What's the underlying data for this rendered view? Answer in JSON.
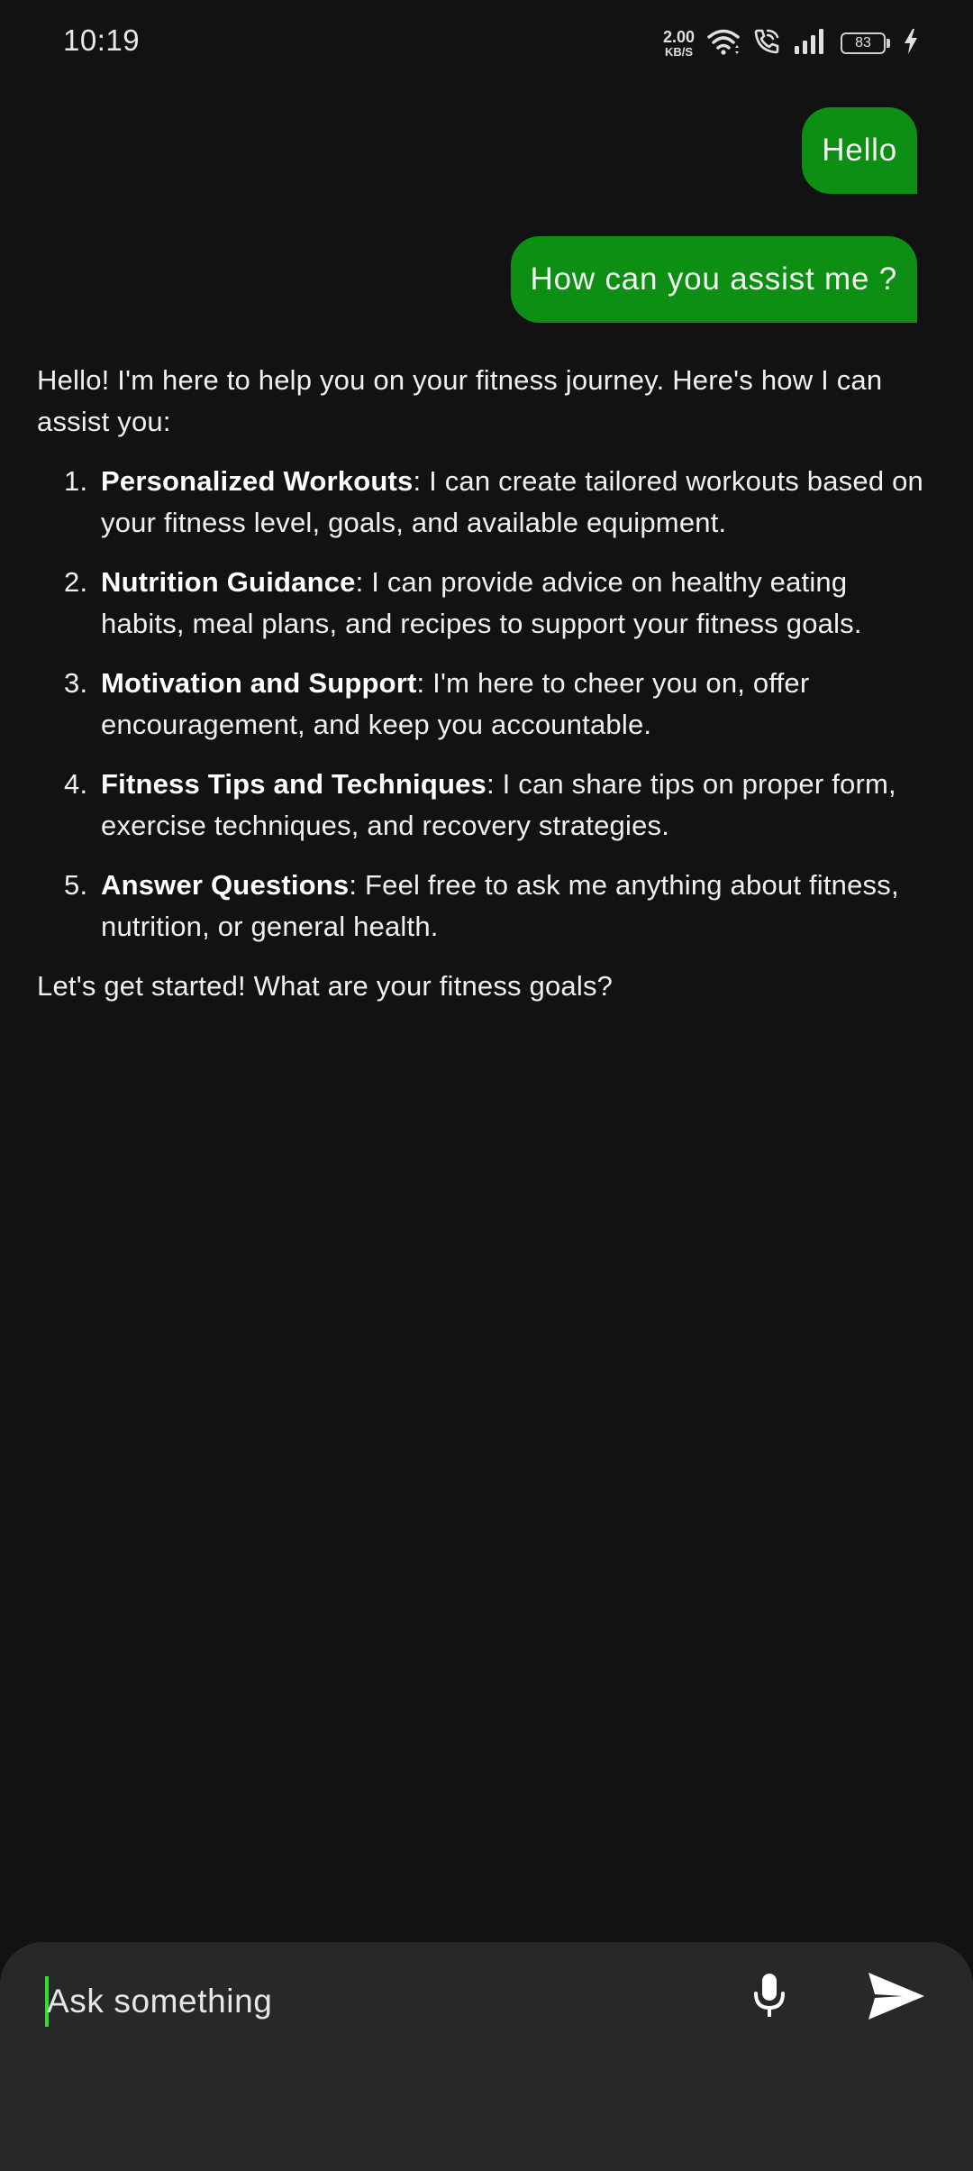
{
  "status_bar": {
    "time": "10:19",
    "net_speed_value": "2.00",
    "net_speed_unit": "KB/S",
    "battery_level": "83",
    "icons": [
      "wifi-icon",
      "wifi-call-icon",
      "signal-icon",
      "battery-icon",
      "charging-icon"
    ]
  },
  "messages": {
    "user": [
      {
        "text": "Hello"
      },
      {
        "text": "How can you assist me ?"
      }
    ],
    "assistant": {
      "intro": "Hello! I'm here to help you on your fitness journey. Here's how I can assist you:",
      "items": [
        {
          "number": "1.",
          "title": "Personalized Workouts",
          "text": ": I can create tailored workouts based on your fitness level, goals, and available equipment."
        },
        {
          "number": "2.",
          "title": "Nutrition Guidance",
          "text": ": I can provide advice on healthy eating habits, meal plans, and recipes to support your fitness goals."
        },
        {
          "number": "3.",
          "title": "Motivation and Support",
          "text": ": I'm here to cheer you on, offer encouragement, and keep you accountable."
        },
        {
          "number": "4.",
          "title": "Fitness Tips and Techniques",
          "text": ": I can share tips on proper form, exercise techniques, and recovery strategies."
        },
        {
          "number": "5.",
          "title": "Answer Questions",
          "text": ": Feel free to ask me anything about fitness, nutrition, or general health."
        }
      ],
      "outro": "Let's get started! What are your fitness goals?"
    }
  },
  "input_bar": {
    "placeholder": "Ask something",
    "value": "",
    "mic_icon": "microphone-icon",
    "send_icon": "send-icon"
  },
  "colors": {
    "background": "#121212",
    "user_bubble": "#0c8f12",
    "input_panel": "#282828",
    "cursor": "#2ee02e"
  }
}
